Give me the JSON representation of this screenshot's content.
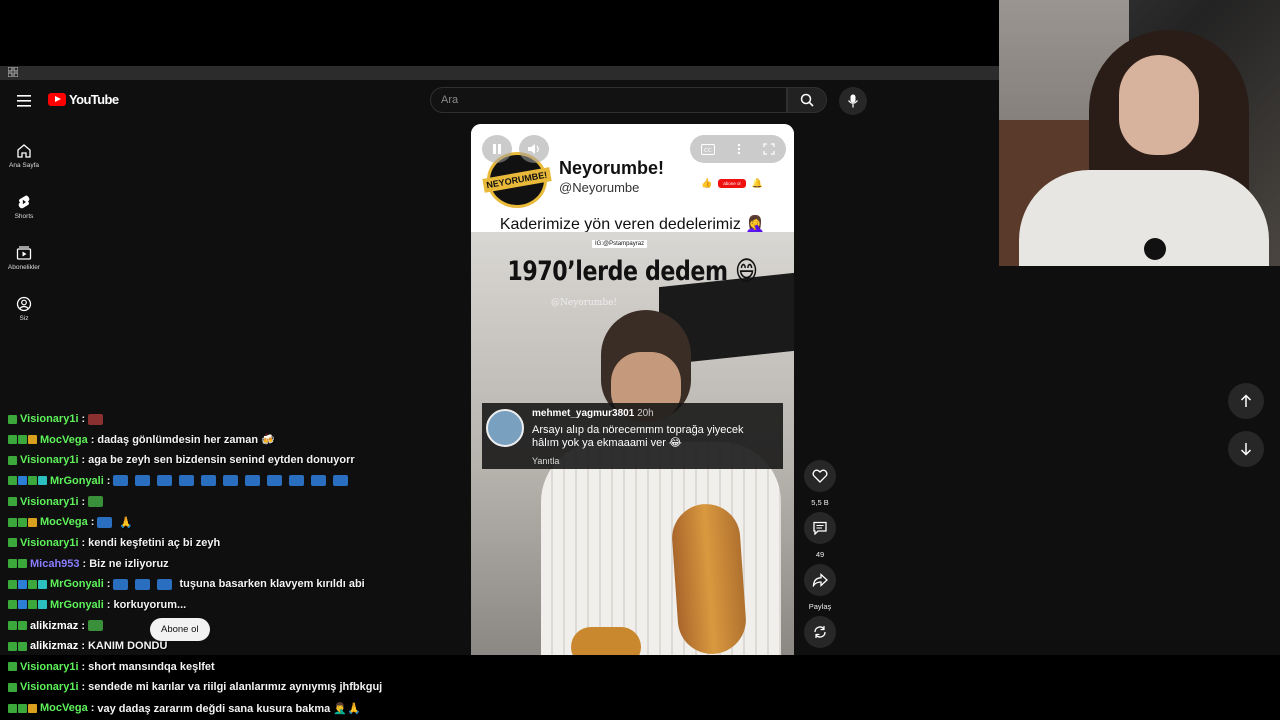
{
  "youtube": {
    "logo_text": "YouTube",
    "search_placeholder": "Ara",
    "sidebar": [
      {
        "label": "Ana Sayfa",
        "icon": "home-icon"
      },
      {
        "label": "Shorts",
        "icon": "shorts-icon"
      },
      {
        "label": "Abonelikler",
        "icon": "subscriptions-icon"
      },
      {
        "label": "Siz",
        "icon": "you-icon"
      }
    ]
  },
  "short": {
    "channel_name": "Neyorumbe!",
    "channel_handle": "@Neyorumbe",
    "badge_text": "NEYORUMBE!",
    "mini_sub_label": "abone ol",
    "caption": "Kaderimize yön veren dedelerimiz 🤦‍♀️",
    "watermark": "IG:@Pstampayraz",
    "overlay_title": "1970’lerde dedem 😄",
    "video_handle": "@Neyorumbe!",
    "comment": {
      "user": "mehmet_yagmur3801",
      "time": "20h",
      "text": "Arsayı alıp da nörecemmm toprağa yiyecek hâlım yok ya ekmaaami ver 😂",
      "reply": "Yanıtla"
    },
    "actions": [
      {
        "icon": "like-icon",
        "label": "5,5 B"
      },
      {
        "icon": "comment-icon",
        "label": "49"
      },
      {
        "icon": "share-icon",
        "label": "Paylaş"
      },
      {
        "icon": "remix-icon",
        "label": ""
      }
    ]
  },
  "chat": {
    "subscribe_tooltip": "Abone ol",
    "messages": [
      {
        "user": "Visionary1i",
        "color": "#5ef25a",
        "badges": [
          "#3aa83a"
        ],
        "text": "",
        "emotes": [
          "#8a3030"
        ]
      },
      {
        "user": "MocVega",
        "color": "#5ef25a",
        "badges": [
          "#3aa83a",
          "#3aa83a",
          "#d9a020"
        ],
        "text": "dadaş gönlümdesin her zaman 🍻",
        "emotes": []
      },
      {
        "user": "Visionary1i",
        "color": "#5ef25a",
        "badges": [
          "#3aa83a"
        ],
        "text": "aga be zeyh sen bizdensin senind eytden donuyorr",
        "emotes": []
      },
      {
        "user": "MrGonyali",
        "color": "#5ef25a",
        "badges": [
          "#3aa83a",
          "#2b7fd6",
          "#3aa83a",
          "#2bbfbf"
        ],
        "text": "",
        "emotes": [
          "#2a6fbf",
          "#2a6fbf",
          "#2a6fbf",
          "#2a6fbf",
          "#2a6fbf",
          "#2a6fbf",
          "#2a6fbf",
          "#2a6fbf",
          "#2a6fbf",
          "#2a6fbf",
          "#2a6fbf"
        ]
      },
      {
        "user": "Visionary1i",
        "color": "#5ef25a",
        "badges": [
          "#3aa83a"
        ],
        "text": "",
        "emotes": [
          "#3a8f3a"
        ]
      },
      {
        "user": "MocVega",
        "color": "#5ef25a",
        "badges": [
          "#3aa83a",
          "#3aa83a",
          "#d9a020"
        ],
        "text": "🙏",
        "emotes": [
          "#2a6fbf"
        ]
      },
      {
        "user": "Visionary1i",
        "color": "#5ef25a",
        "badges": [
          "#3aa83a"
        ],
        "text": "kendi keşfetini aç bi zeyh",
        "emotes": []
      },
      {
        "user": "Micah953",
        "color": "#8a7dff",
        "badges": [
          "#3aa83a",
          "#3aa83a"
        ],
        "text": "Biz ne izliyoruz",
        "emotes": []
      },
      {
        "user": "MrGonyali",
        "color": "#5ef25a",
        "badges": [
          "#3aa83a",
          "#2b7fd6",
          "#3aa83a",
          "#2bbfbf"
        ],
        "text": "tuşuna basarken klavyem kırıldı abi",
        "emotes": [
          "#2a6fbf",
          "#2a6fbf",
          "#2a6fbf"
        ]
      },
      {
        "user": "MrGonyali",
        "color": "#5ef25a",
        "badges": [
          "#3aa83a",
          "#2b7fd6",
          "#3aa83a",
          "#2bbfbf"
        ],
        "text": "korkuyorum...",
        "emotes": []
      },
      {
        "user": "alikizmaz",
        "color": "#ffffff",
        "badges": [
          "#3aa83a",
          "#3aa83a"
        ],
        "text": "",
        "emotes": [
          "#3a8f3a"
        ]
      },
      {
        "user": "alikizmaz",
        "color": "#ffffff",
        "badges": [
          "#3aa83a",
          "#3aa83a"
        ],
        "text": "KANIM DONDU",
        "emotes": []
      },
      {
        "user": "Visionary1i",
        "color": "#5ef25a",
        "badges": [
          "#3aa83a"
        ],
        "text": "short mansındqa keşlfet",
        "emotes": []
      },
      {
        "user": "Visionary1i",
        "color": "#5ef25a",
        "badges": [
          "#3aa83a"
        ],
        "text": "sendede mi karılar va riilgi alanlarımız aynıymış jhfbkguj",
        "emotes": []
      },
      {
        "user": "MocVega",
        "color": "#5ef25a",
        "badges": [
          "#3aa83a",
          "#3aa83a",
          "#d9a020"
        ],
        "text": "vay dadaş zararım değdi sana kusura bakma 🤦‍♂️🙏",
        "emotes": []
      }
    ]
  }
}
